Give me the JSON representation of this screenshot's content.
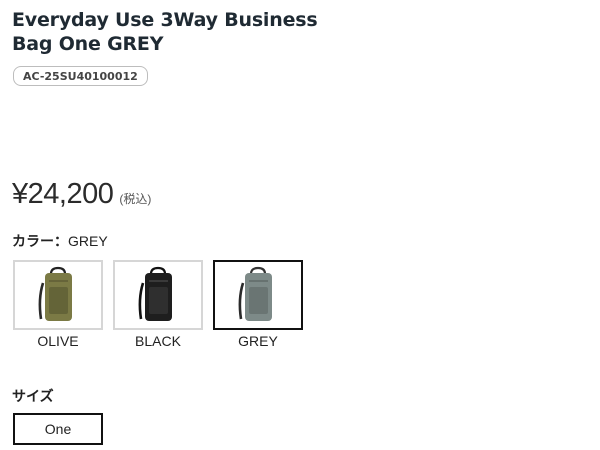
{
  "product": {
    "title": "Everyday Use 3Way Business Bag One GREY",
    "sku": "AC-25SU40100012",
    "price": "¥24,200",
    "tax_note": "(税込)"
  },
  "color": {
    "label": "カラー：",
    "selected": "GREY",
    "options": [
      {
        "name": "OLIVE",
        "icon": "backpack-olive-image",
        "body_color": "#7b7a45",
        "selected": false
      },
      {
        "name": "BLACK",
        "icon": "backpack-black-image",
        "body_color": "#1e1e1e",
        "selected": false
      },
      {
        "name": "GREY",
        "icon": "backpack-grey-image",
        "body_color": "#7d8a88",
        "selected": true
      }
    ]
  },
  "size": {
    "label": "サイズ",
    "options": [
      {
        "name": "One",
        "selected": true
      }
    ]
  }
}
